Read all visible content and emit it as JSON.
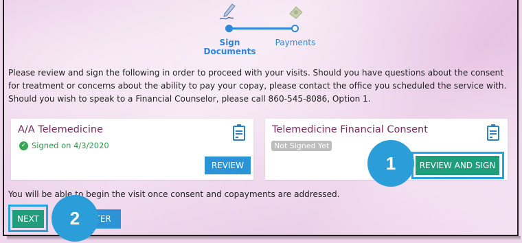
{
  "stepper": {
    "steps": [
      {
        "label": "Sign Documents",
        "icon": "pen-icon",
        "state": "active"
      },
      {
        "label": "Payments",
        "icon": "cash-icon",
        "state": "pending"
      }
    ]
  },
  "intro_text": "Please review and sign the following in order to proceed with your visits. Should you have questions about the consent for treatment or concerns about the ability to pay your copay, please contact the office you scheduled the service with. Should you wish to speak to a Financial Counselor, please call 860-545-8086, Option 1.",
  "documents": [
    {
      "title": "A/A Telemedicine",
      "status": "Signed on 4/3/2020",
      "status_icon": "check-circle-icon",
      "button": "REVIEW"
    },
    {
      "title": "Telemedicine Financial Consent",
      "status": "Not Signed Yet",
      "button": "REVIEW AND SIGN"
    }
  ],
  "footnote": "You will be able to begin the visit once consent and copayments are addressed.",
  "actions": {
    "next": "NEXT",
    "later": "LATER"
  },
  "callouts": [
    "1",
    "2"
  ],
  "colors": {
    "primary_blue": "#2a94d6",
    "green": "#1f9e7c",
    "title_maroon": "#7a2a5e",
    "callout_blue": "#2b9dd8"
  }
}
